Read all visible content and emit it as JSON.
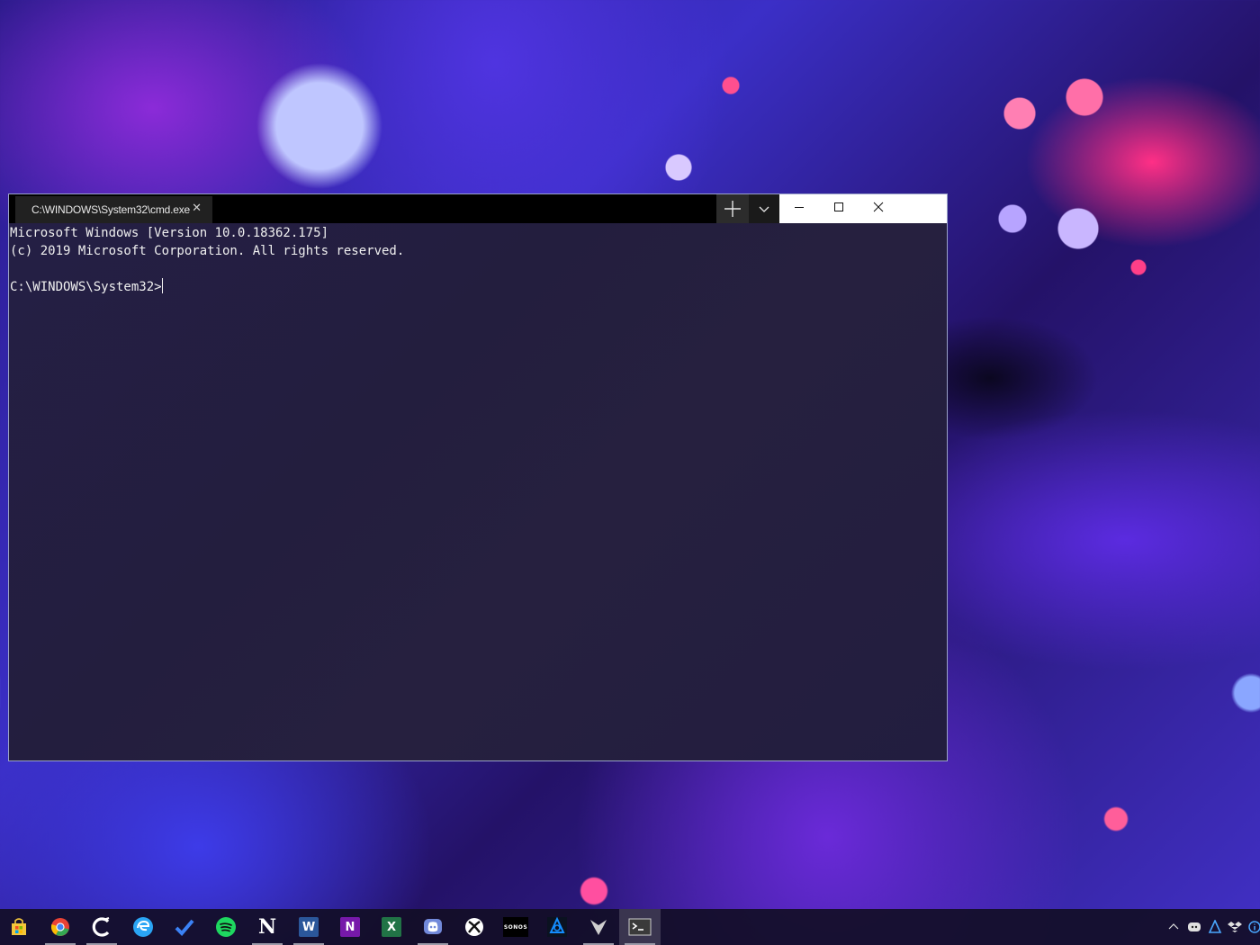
{
  "window": {
    "tab_title": "C:\\WINDOWS\\System32\\cmd.exe",
    "tab_close_glyph": "✕",
    "new_tab_icon": "plus-icon",
    "dropdown_icon": "chevron-down-icon"
  },
  "console": {
    "lines": [
      "Microsoft Windows [Version 10.0.18362.175]",
      "(c) 2019 Microsoft Corporation. All rights reserved.",
      "",
      "C:\\WINDOWS\\System32>"
    ]
  },
  "taskbar": {
    "items": [
      {
        "name": "microsoft-store-icon",
        "color": "#f3c63a",
        "running": false
      },
      {
        "name": "chrome-icon",
        "color": "#e94235",
        "running": true
      },
      {
        "name": "ccleaner-icon",
        "color": "#ffffff",
        "running": true
      },
      {
        "name": "edge-insider-icon",
        "color": "#2aa5f5",
        "running": false
      },
      {
        "name": "todo-icon",
        "color": "#3b82f6",
        "running": false
      },
      {
        "name": "spotify-icon",
        "color": "#1ed760",
        "running": false
      },
      {
        "name": "notion-icon",
        "color": "#ffffff",
        "running": true
      },
      {
        "name": "word-icon",
        "color": "#2b579a",
        "running": true
      },
      {
        "name": "onenote-icon",
        "color": "#7719aa",
        "running": false
      },
      {
        "name": "excel-icon",
        "color": "#217346",
        "running": false
      },
      {
        "name": "discord-icon",
        "color": "#7289da",
        "running": true
      },
      {
        "name": "xbox-icon",
        "color": "#ffffff",
        "running": false
      },
      {
        "name": "sonos-icon",
        "color": "#000000",
        "running": false
      },
      {
        "name": "battle-net-icon",
        "color": "#148eff",
        "running": false
      },
      {
        "name": "destiny-icon",
        "color": "#cfcfcf",
        "running": true
      },
      {
        "name": "terminal-icon",
        "color": "#3a3a3a",
        "running": true
      }
    ],
    "labels": {
      "sonos": "SONOS",
      "word": "W",
      "onenote": "N",
      "excel": "X",
      "notion": "N"
    },
    "tray": [
      "chevron-up-icon",
      "discord-tray-icon",
      "network-tray-icon",
      "dropbox-tray-icon",
      "info-tray-icon"
    ]
  }
}
